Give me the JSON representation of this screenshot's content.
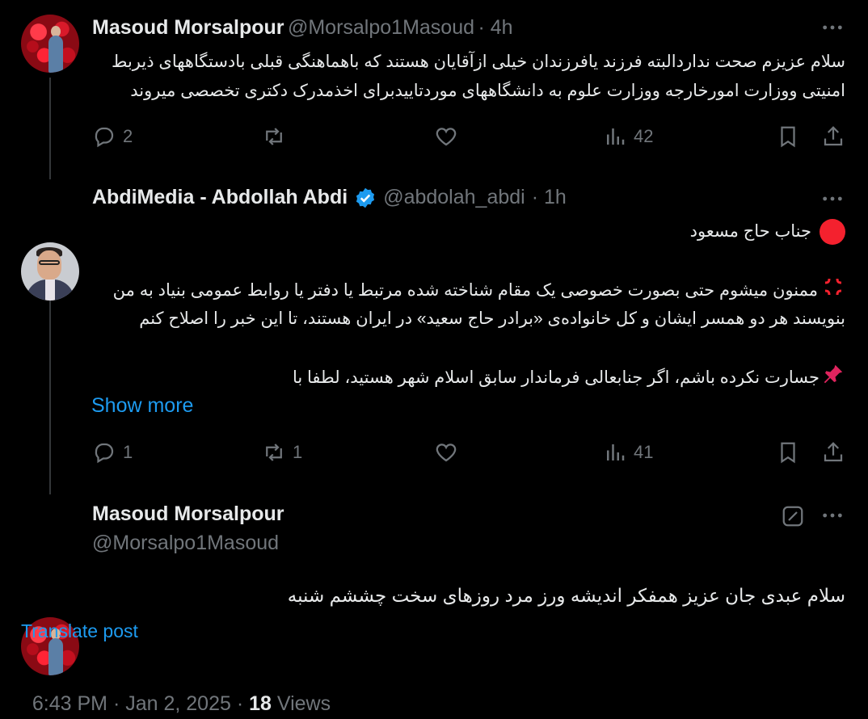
{
  "tweet1": {
    "name": "Masoud Morsalpour",
    "handle": "@Morsalpo1Masoud",
    "time": "· 4h",
    "line1": "سلام عزیزم صحت ندارد‌البته فرزند یافرزندان خیلی از‌آقایان هستند که باهماهنگی قبلی بادستگاههای ذیربط",
    "line2": "امنیتی ووزارت امورخارجه ووزارت علوم به دانشگاههای موردتاییدبرای اخذمدرک دکتری تخصصی میروند",
    "replies": "2",
    "retweets": "",
    "likes": "",
    "views": "42"
  },
  "tweet2": {
    "name": "AbdiMedia - Abdollah Abdi",
    "handle": "@abdolah_abdi",
    "time": "· 1h",
    "line1": "جناب حاج مسعود",
    "line2": "ممنون میشوم حتی بصورت خصوصی یک مقام شناخته شده مرتبط یا دفتر یا روابط عمومی بنیاد به من",
    "line3": "بنویسند هر دو همسر ایشان و کل خانواده‌ی «برادر حاج سعید» در ایران هستند، تا این خبر را اصلاح کنم",
    "line4": "جسارت نکرده باشم، اگر جنابعالی فرماندار سابق اسلام شهر هستید، لطفا با",
    "show_more": "Show more",
    "replies": "1",
    "retweets": "1",
    "likes": "",
    "views": "41"
  },
  "main": {
    "name": "Masoud Morsalpour",
    "handle": "@Morsalpo1Masoud",
    "text": "سلام عبدی جان عزیز همفکر اندیشه ورز مرد روزهای سخت چششم شنبه",
    "translate": "Translate post",
    "time": "6:43 PM · Jan 2, 2025 · ",
    "views_count": "18",
    "views_label": "Views"
  },
  "colors": {
    "accent": "#1d9bf0",
    "muted": "#71767b",
    "text": "#e7e9ea",
    "red_circle": "#f4212e"
  },
  "icons": [
    "reply-icon",
    "retweet-icon",
    "like-icon",
    "views-icon",
    "bookmark-icon",
    "share-icon",
    "more-icon",
    "verified-icon",
    "grok-icon",
    "red-circle-icon",
    "anger-icon",
    "pushpin-icon"
  ]
}
